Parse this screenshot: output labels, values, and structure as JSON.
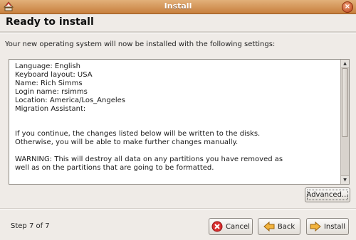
{
  "window": {
    "title": "Install",
    "icons": {
      "app": "installer-icon",
      "close": "close-icon"
    }
  },
  "header": {
    "title": "Ready to install"
  },
  "intro_text": "Your new operating system will now be installed with the following settings:",
  "summary": {
    "lines": [
      "Language: English",
      "Keyboard layout: USA",
      "Name: Rich Simms",
      "Login name: rsimms",
      "Location: America/Los_Angeles",
      "Migration Assistant:",
      "",
      "",
      "If you continue, the changes listed below will be written to the disks.",
      "Otherwise, you will be able to make further changes manually.",
      "",
      "WARNING: This will destroy all data on any partitions you have removed as",
      "well as on the partitions that are going to be formatted."
    ]
  },
  "buttons": {
    "advanced": "Advanced...",
    "cancel": "Cancel",
    "back": "Back",
    "install": "Install"
  },
  "footer": {
    "step": "Step 7 of 7"
  },
  "colors": {
    "titlebar": "#c77f3d",
    "window_bg": "#efebe7"
  }
}
